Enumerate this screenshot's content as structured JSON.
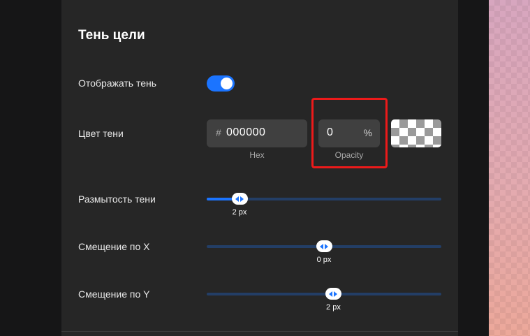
{
  "section": {
    "title": "Тень цели"
  },
  "show_shadow": {
    "label": "Отображать тень",
    "enabled": true
  },
  "shadow_color": {
    "label": "Цвет тени",
    "hex_symbol": "#",
    "hex_value": "000000",
    "hex_caption": "Hex",
    "opacity_value": "0",
    "opacity_unit": "%",
    "opacity_caption": "Opacity"
  },
  "blur": {
    "label": "Размытость тени",
    "value_text": "2 px",
    "level_fraction": 0.14
  },
  "offset_x": {
    "label": "Смещение по X",
    "value_text": "0 px",
    "level_fraction": 0.5
  },
  "offset_y": {
    "label": "Смещение по Y",
    "value_text": "2 px",
    "level_fraction": 0.54
  },
  "colors": {
    "accent": "#1b74ff",
    "highlight": "#ec1a1a",
    "panel": "#262626"
  }
}
